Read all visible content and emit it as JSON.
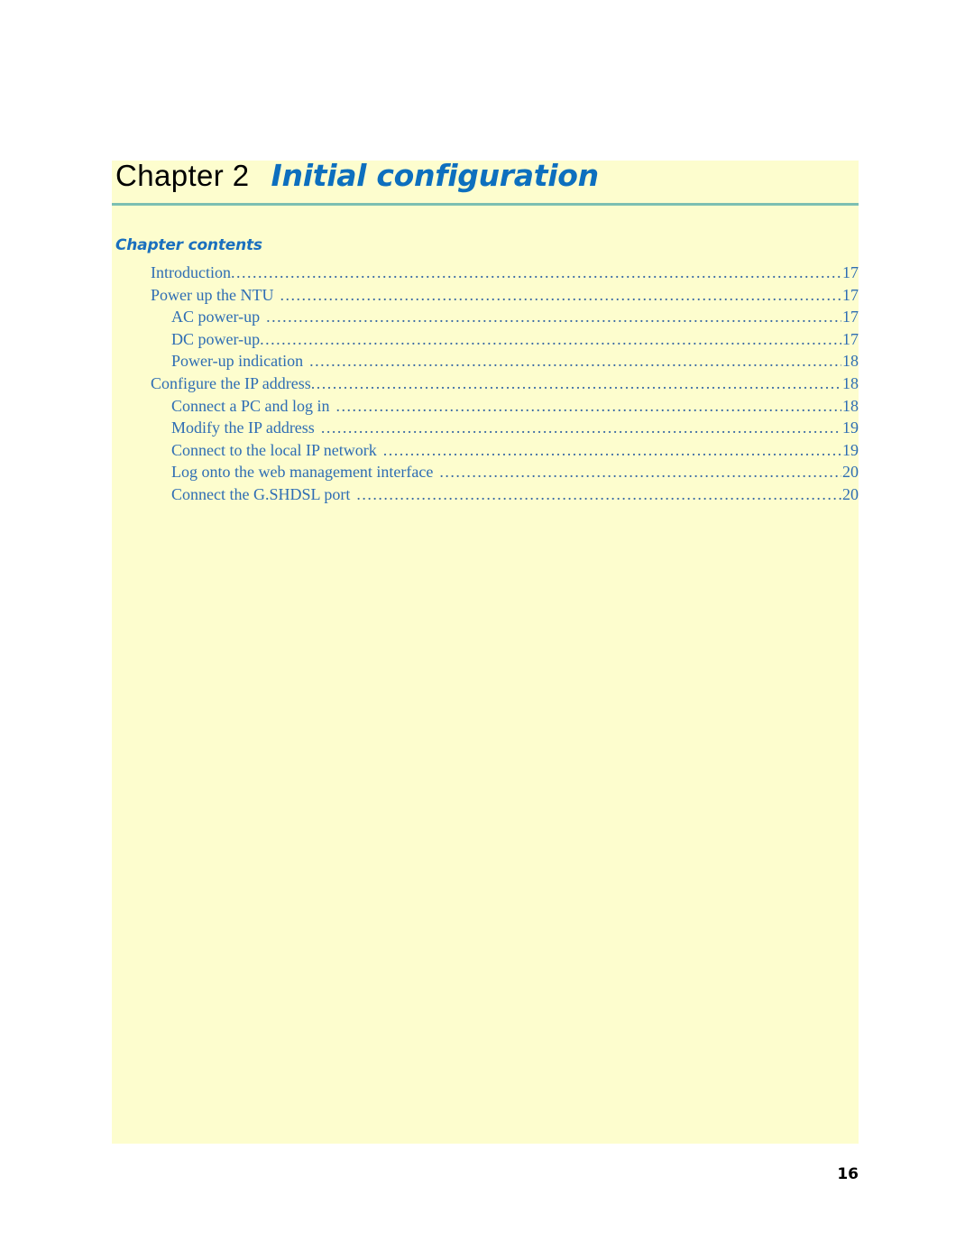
{
  "page": {
    "folio": "16",
    "background_color": "#ffffff",
    "panel_color": "#fdfdce",
    "rule_color": "#7cbfb2",
    "accent_color": "#0d6fbe",
    "toc_text_color": "#2e6db4"
  },
  "heading": {
    "chapter_label": "Chapter 2",
    "chapter_title": "Initial configuration"
  },
  "contents": {
    "heading": "Chapter contents",
    "entries": [
      {
        "label": "Introduction",
        "page": "17",
        "level": 1,
        "spaced": false
      },
      {
        "label": "Power up the NTU",
        "page": "17",
        "level": 1,
        "spaced": true
      },
      {
        "label": "AC power-up",
        "page": "17",
        "level": 2,
        "spaced": true
      },
      {
        "label": "DC power-up",
        "page": "17",
        "level": 2,
        "spaced": false
      },
      {
        "label": "Power-up indication",
        "page": "18",
        "level": 2,
        "spaced": true
      },
      {
        "label": "Configure the IP address",
        "page": "18",
        "level": 1,
        "spaced": false
      },
      {
        "label": "Connect a PC and log in",
        "page": "18",
        "level": 2,
        "spaced": true
      },
      {
        "label": "Modify the IP address",
        "page": "19",
        "level": 2,
        "spaced": true
      },
      {
        "label": "Connect to the local IP network",
        "page": "19",
        "level": 2,
        "spaced": true
      },
      {
        "label": "Log onto the web management interface",
        "page": "20",
        "level": 2,
        "spaced": true
      },
      {
        "label": "Connect the G.SHDSL port",
        "page": "20",
        "level": 2,
        "spaced": true
      }
    ]
  }
}
